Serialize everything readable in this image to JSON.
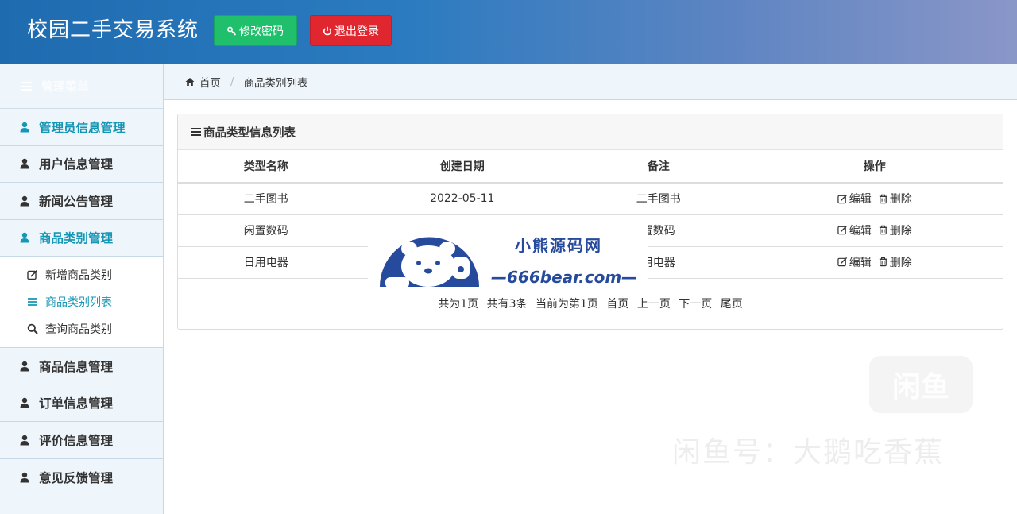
{
  "header": {
    "title": "校园二手交易系统",
    "change_password_label": "修改密码",
    "logout_label": "退出登录",
    "colors": {
      "change_password_bg": "#1fbf6b",
      "logout_bg": "#e0262f"
    }
  },
  "sidebar": {
    "heading": "管理菜单",
    "items": [
      {
        "label": "管理员信息管理",
        "active": true
      },
      {
        "label": "用户信息管理"
      },
      {
        "label": "新闻公告管理"
      },
      {
        "label": "商品类别管理",
        "active": true
      }
    ],
    "submenu": [
      {
        "label": "新增商品类别",
        "icon": "edit-icon"
      },
      {
        "label": "商品类别列表",
        "icon": "list-icon",
        "active": true
      },
      {
        "label": "查询商品类别",
        "icon": "search-icon"
      }
    ],
    "items_after": [
      {
        "label": "商品信息管理"
      },
      {
        "label": "订单信息管理"
      },
      {
        "label": "评价信息管理"
      },
      {
        "label": "意见反馈管理"
      }
    ],
    "accent_color": "#1596b5"
  },
  "breadcrumb": {
    "home": "首页",
    "current": "商品类别列表"
  },
  "panel": {
    "title": "商品类型信息列表",
    "columns": [
      "类型名称",
      "创建日期",
      "备注",
      "操作"
    ],
    "rows": [
      {
        "name": "二手图书",
        "date": "2022-05-11",
        "note": "二手图书"
      },
      {
        "name": "闲置数码",
        "date": "",
        "note": "置数码"
      },
      {
        "name": "日用电器",
        "date": "",
        "note": "用电器"
      }
    ],
    "edit_label": "编辑",
    "delete_label": "删除"
  },
  "pager": {
    "total_pages": "共为1页",
    "total_items": "共有3条",
    "current_page": "当前为第1页",
    "first": "首页",
    "prev": "上一页",
    "next": "下一页",
    "last": "尾页"
  },
  "watermarks": {
    "bear_title": "小熊源码网",
    "bear_url": "—666bear.com—",
    "xianyu_badge": "闲鱼",
    "xianyu_text": "闲鱼号：大鹅吃香蕉"
  }
}
